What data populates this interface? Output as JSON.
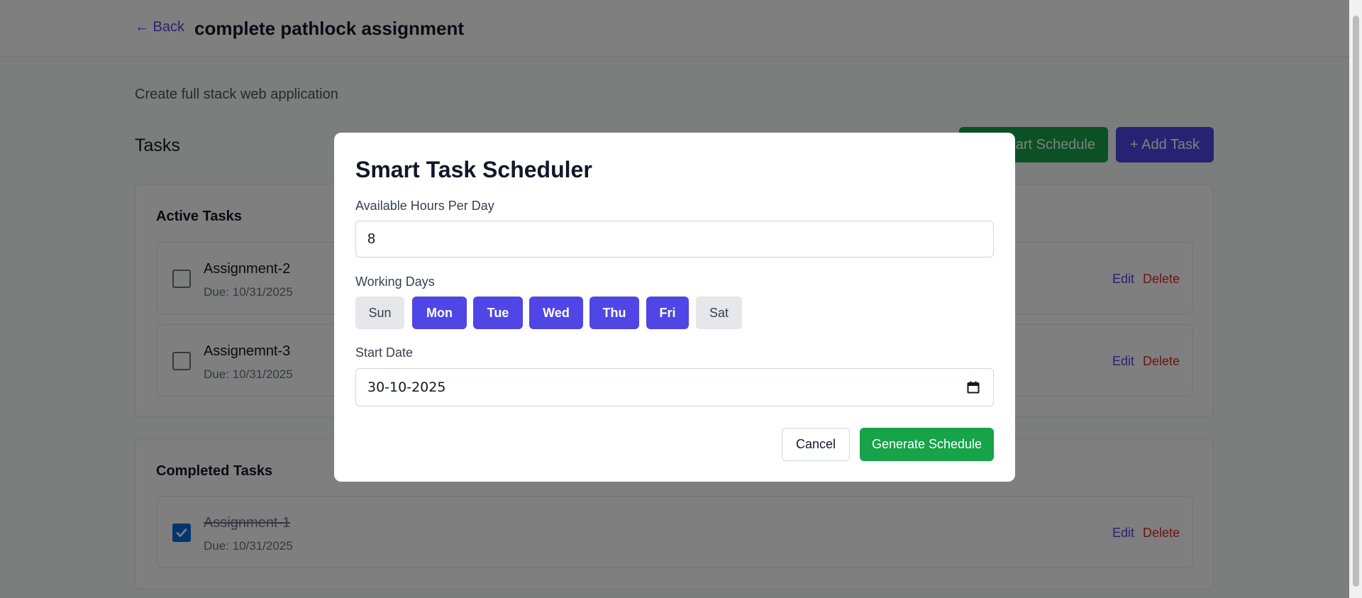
{
  "header": {
    "back_label": "← Back",
    "title": "complete pathlock assignment"
  },
  "project": {
    "description": "Create full stack web application",
    "tasks_heading": "Tasks",
    "smart_schedule_label": "Smart Schedule",
    "add_task_label": "+ Add Task"
  },
  "active": {
    "title": "Active Tasks",
    "tasks": [
      {
        "name": "Assignment-2",
        "due": "Due: 10/31/2025",
        "edit": "Edit",
        "delete": "Delete",
        "done": false
      },
      {
        "name": "Assignemnt-3",
        "due": "Due: 10/31/2025",
        "edit": "Edit",
        "delete": "Delete",
        "done": false
      }
    ]
  },
  "completed": {
    "title": "Completed Tasks",
    "tasks": [
      {
        "name": "Assignment-1",
        "due": "Due: 10/31/2025",
        "edit": "Edit",
        "delete": "Delete",
        "done": true
      }
    ]
  },
  "modal": {
    "title": "Smart Task Scheduler",
    "hours_label": "Available Hours Per Day",
    "hours_value": "8",
    "days_label": "Working Days",
    "days": [
      {
        "label": "Sun",
        "selected": false
      },
      {
        "label": "Mon",
        "selected": true
      },
      {
        "label": "Tue",
        "selected": true
      },
      {
        "label": "Wed",
        "selected": true
      },
      {
        "label": "Thu",
        "selected": true
      },
      {
        "label": "Fri",
        "selected": true
      },
      {
        "label": "Sat",
        "selected": false
      }
    ],
    "date_label": "Start Date",
    "date_value": "30-10-2025",
    "cancel_label": "Cancel",
    "generate_label": "Generate Schedule"
  },
  "colors": {
    "primary": "#4f46e5",
    "success": "#16a34a",
    "danger": "#dc2626",
    "checkbox_checked": "#0b6bdc"
  }
}
